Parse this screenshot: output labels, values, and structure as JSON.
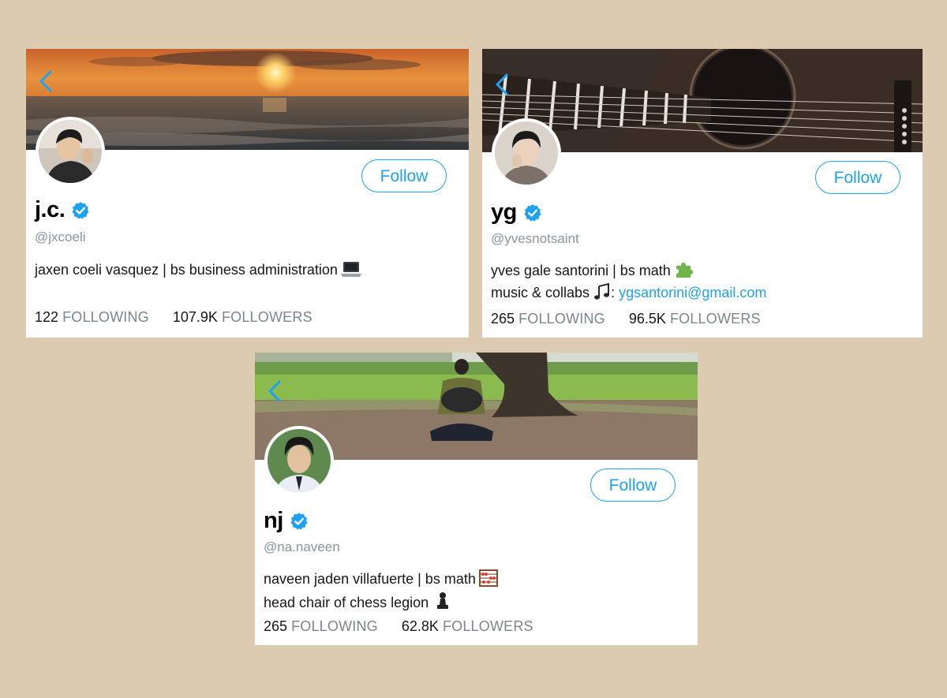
{
  "colors": {
    "background": "#dccbb0",
    "accent": "#1da1f2",
    "muted": "#7a858f"
  },
  "profiles": [
    {
      "display_name": "j.c.",
      "handle": "@jxcoeli",
      "verified": true,
      "follow_label": "Follow",
      "bio_lines": [
        "jaxen coeli vasquez | bs business administration"
      ],
      "bio_emoji": [
        "laptop-emoji"
      ],
      "following_count": "122",
      "following_label": "FOLLOWING",
      "followers_count": "107.9K",
      "followers_label": "FOLLOWERS",
      "banner": "sunset-over-sea"
    },
    {
      "display_name": "yg",
      "handle": "@yvesnotsaint",
      "verified": true,
      "follow_label": "Follow",
      "bio_lines": [
        "yves gale santorini | bs math",
        "music & collabs"
      ],
      "bio_link": "ygsantorini@gmail.com",
      "bio_emoji": [
        "puzzle-piece-emoji",
        "music-notes-emoji"
      ],
      "following_count": "265",
      "following_label": "FOLLOWING",
      "followers_count": "96.5K",
      "followers_label": "FOLLOWERS",
      "banner": "acoustic-guitar"
    },
    {
      "display_name": "nj",
      "handle": "@na.naveen",
      "verified": true,
      "follow_label": "Follow",
      "bio_lines": [
        "naveen jaden villafuerte | bs math",
        "head chair of chess legion"
      ],
      "bio_emoji": [
        "abacus-emoji",
        "chess-pawn-emoji"
      ],
      "following_count": "265",
      "following_label": "FOLLOWING",
      "followers_count": "62.8K",
      "followers_label": "FOLLOWERS",
      "banner": "person-sitting-under-tree"
    }
  ]
}
